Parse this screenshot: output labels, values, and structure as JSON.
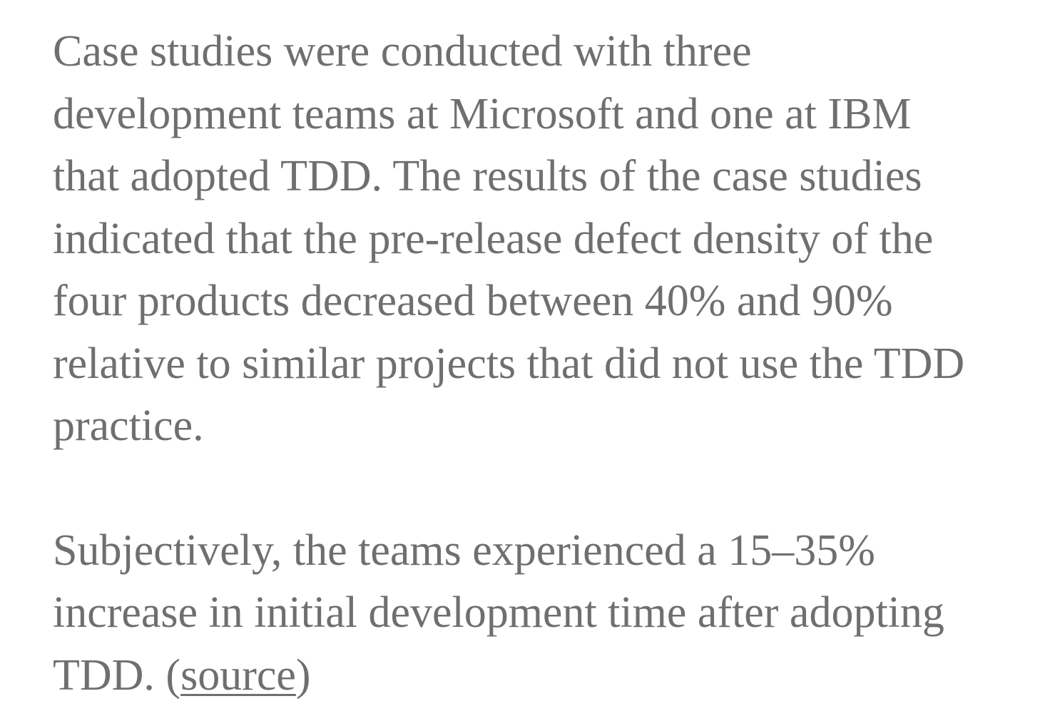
{
  "article": {
    "paragraph_1": {
      "lines": [
        "Case studies were conducted with three",
        "development teams at Microsoft and one at IBM",
        "that adopted TDD. The results of the case studies",
        "indicated that the pre-release defect density of the",
        "four products decreased between 40% and 90%",
        "relative to similar projects that did not use the TDD",
        "practice."
      ]
    },
    "paragraph_2": {
      "lines": [
        "Subjectively, the teams experienced a 15–35%",
        "increase in initial development time after adopting"
      ],
      "last_line_prefix": "TDD. (",
      "link_text": "source",
      "last_line_suffix": ")"
    }
  }
}
